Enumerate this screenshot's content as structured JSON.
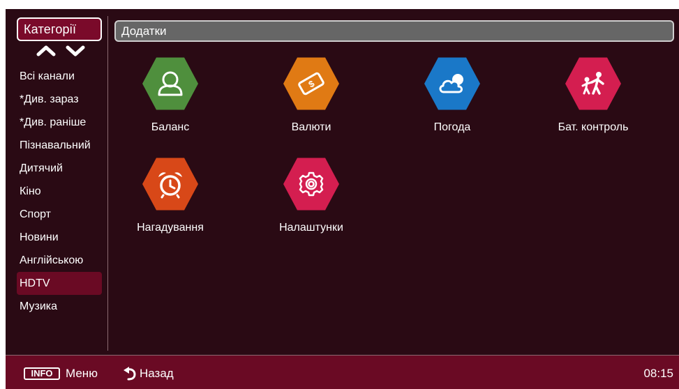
{
  "sidebar": {
    "title": "Категорії",
    "items": [
      {
        "label": "Всі канали"
      },
      {
        "label": "*Див. зараз"
      },
      {
        "label": "*Див. раніше"
      },
      {
        "label": "Пізнавальний"
      },
      {
        "label": "Дитячий"
      },
      {
        "label": "Кіно"
      },
      {
        "label": "Спорт"
      },
      {
        "label": "Новини"
      },
      {
        "label": "Англійською"
      },
      {
        "label": "HDTV",
        "selected": true
      },
      {
        "label": "Музика"
      }
    ]
  },
  "main": {
    "title": "Додатки",
    "apps": [
      {
        "label": "Баланс",
        "icon": "user-icon",
        "color": "#4f8f3d"
      },
      {
        "label": "Валюти",
        "icon": "money-icon",
        "color": "#e07a14"
      },
      {
        "label": "Погода",
        "icon": "cloud-icon",
        "color": "#1a78c8"
      },
      {
        "label": "Бат. контроль",
        "icon": "parental-icon",
        "color": "#d41e50"
      },
      {
        "label": "Нагадування",
        "icon": "alarm-clock-icon",
        "color": "#d84818"
      },
      {
        "label": "Налаштунки",
        "icon": "gear-icon",
        "color": "#d41e50"
      }
    ]
  },
  "bottom_bar": {
    "info_key": "INFO",
    "menu_label": "Меню",
    "back_label": "Назад",
    "clock": "08:15"
  },
  "colors": {
    "background": "#2a0a14",
    "accent": "#6a0a24",
    "header_bar": "#666666"
  }
}
